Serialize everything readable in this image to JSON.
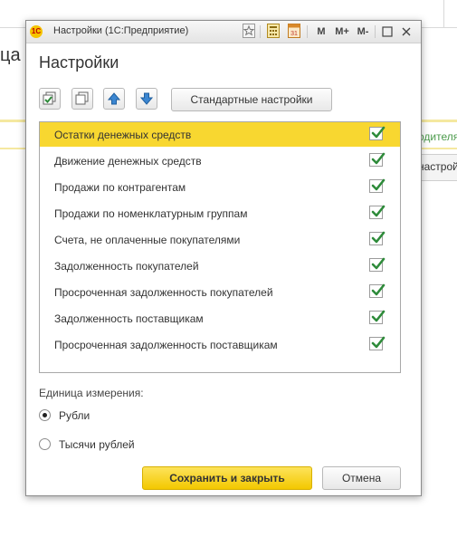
{
  "background": {
    "title_fragment": "ца",
    "right_fragment_1": "одителя",
    "right_fragment_2": "настройки"
  },
  "window": {
    "title": "Настройки  (1С:Предприятие)",
    "logo_text": "1С",
    "toolbar": {
      "m_label": "M",
      "mplus_label": "M+",
      "mminus_label": "M-",
      "calendar_day": "31"
    }
  },
  "form": {
    "title": "Настройки",
    "standard_settings_label": "Стандартные настройки"
  },
  "reports": [
    {
      "label": "Остатки денежных средств",
      "checked": true,
      "selected": true
    },
    {
      "label": "Движение денежных средств",
      "checked": true,
      "selected": false
    },
    {
      "label": "Продажи по контрагентам",
      "checked": true,
      "selected": false
    },
    {
      "label": "Продажи по номенклатурным группам",
      "checked": true,
      "selected": false
    },
    {
      "label": "Счета, не оплаченные покупателями",
      "checked": true,
      "selected": false
    },
    {
      "label": "Задолженность покупателей",
      "checked": true,
      "selected": false
    },
    {
      "label": "Просроченная задолженность покупателей",
      "checked": true,
      "selected": false
    },
    {
      "label": "Задолженность поставщикам",
      "checked": true,
      "selected": false
    },
    {
      "label": "Просроченная задолженность поставщикам",
      "checked": true,
      "selected": false
    }
  ],
  "units": {
    "label": "Единица измерения:",
    "options": [
      {
        "label": "Рубли",
        "selected": true
      },
      {
        "label": "Тысячи рублей",
        "selected": false
      }
    ]
  },
  "buttons": {
    "save": "Сохранить и закрыть",
    "cancel": "Отмена"
  },
  "colors": {
    "selected_row": "#f8d730",
    "primary_button": "#f3c800",
    "checkmark": "#2e8b3a"
  }
}
